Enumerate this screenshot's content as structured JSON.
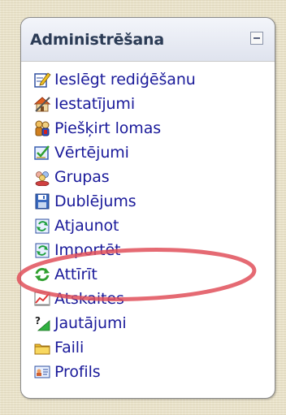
{
  "block": {
    "title": "Administrēšana"
  },
  "menu": [
    {
      "icon": "edit-icon",
      "label": "Ieslēgt rediģēšanu"
    },
    {
      "icon": "settings-icon",
      "label": "Iestatījumi"
    },
    {
      "icon": "assign-roles-icon",
      "label": "Piešķirt lomas"
    },
    {
      "icon": "grades-icon",
      "label": "Vērtējumi"
    },
    {
      "icon": "groups-icon",
      "label": "Grupas"
    },
    {
      "icon": "backup-icon",
      "label": "Dublējums"
    },
    {
      "icon": "restore-icon",
      "label": "Atjaunot"
    },
    {
      "icon": "import-icon",
      "label": "Importēt"
    },
    {
      "icon": "reset-icon",
      "label": "Attīrīt"
    },
    {
      "icon": "reports-icon",
      "label": "Atskaites"
    },
    {
      "icon": "questions-icon",
      "label": "Jautājumi"
    },
    {
      "icon": "files-icon",
      "label": "Faili"
    },
    {
      "icon": "profile-icon",
      "label": "Profils"
    }
  ],
  "colors": {
    "link": "#1a1a9a",
    "title": "#2b3b55",
    "highlight": "#e0505a",
    "background": "#ebe4cc"
  }
}
